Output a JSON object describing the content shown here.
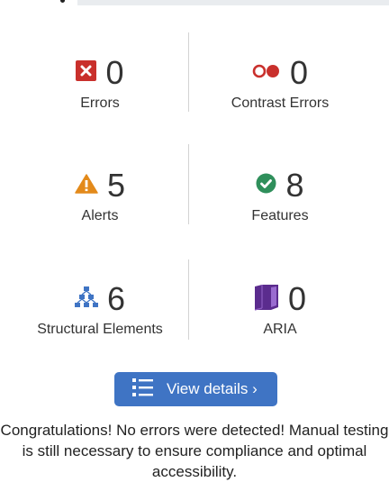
{
  "summary": {
    "errors": {
      "label": "Errors",
      "count": "0",
      "icon": "error-x-icon",
      "color": "#c9302c"
    },
    "contrast_errors": {
      "label": "Contrast Errors",
      "count": "0",
      "icon": "contrast-circles-icon",
      "color": "#c9302c"
    },
    "alerts": {
      "label": "Alerts",
      "count": "5",
      "icon": "alert-triangle-icon",
      "color": "#e38a1b"
    },
    "features": {
      "label": "Features",
      "count": "8",
      "icon": "check-circle-icon",
      "color": "#2f8f5b"
    },
    "structural": {
      "label": "Structural Elements",
      "count": "6",
      "icon": "hierarchy-icon",
      "color": "#3f74c4"
    },
    "aria": {
      "label": "ARIA",
      "count": "0",
      "icon": "aria-cube-icon",
      "color": "#5b2c8e"
    }
  },
  "details_button": {
    "label": "View details ›",
    "icon": "list-icon",
    "color": "#3f74c4"
  },
  "message": "Congratulations! No errors were detected! Manual testing is still necessary to ensure compliance and optimal accessibility."
}
